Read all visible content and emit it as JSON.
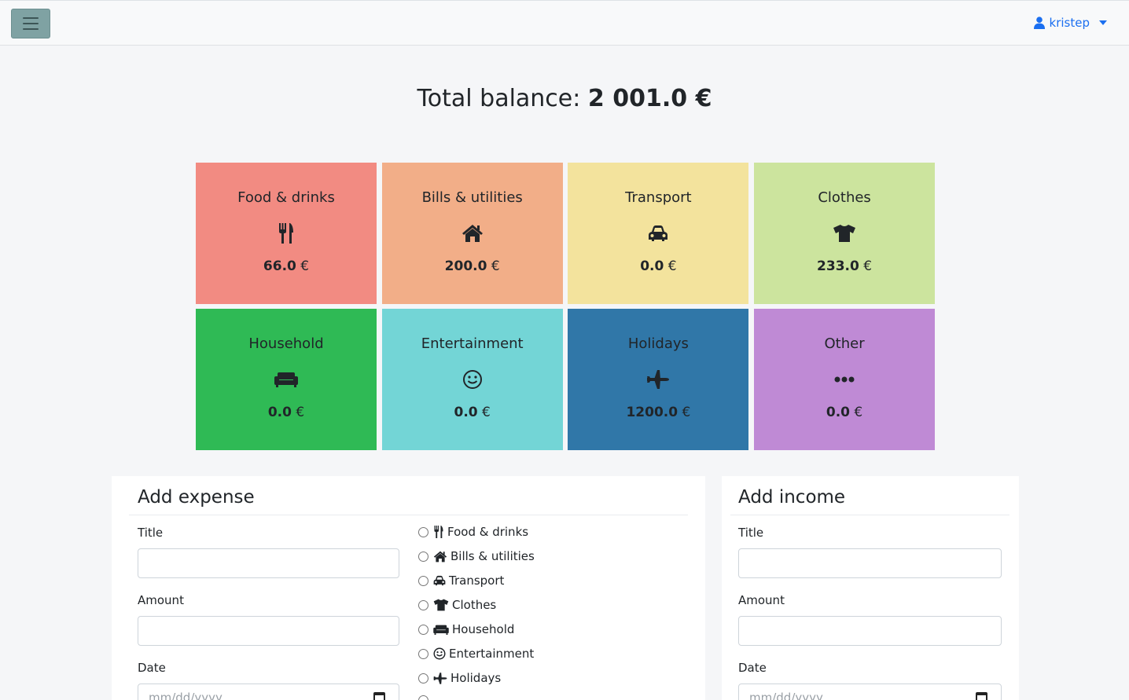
{
  "user": {
    "name": "kristep"
  },
  "total": {
    "label": "Total balance:",
    "amount": "2 001.0 €"
  },
  "categories": [
    {
      "name": "Food & drinks",
      "amount": "66.0",
      "currency": "€",
      "color": "#f28b82",
      "icon": "utensils-icon"
    },
    {
      "name": "Bills & utilities",
      "amount": "200.0",
      "currency": "€",
      "color": "#f2ae88",
      "icon": "home-icon"
    },
    {
      "name": "Transport",
      "amount": "0.0",
      "currency": "€",
      "color": "#f3e39d",
      "icon": "car-icon"
    },
    {
      "name": "Clothes",
      "amount": "233.0",
      "currency": "€",
      "color": "#cce49e",
      "icon": "tshirt-icon"
    },
    {
      "name": "Household",
      "amount": "0.0",
      "currency": "€",
      "color": "#2fba55",
      "icon": "couch-icon"
    },
    {
      "name": "Entertainment",
      "amount": "0.0",
      "currency": "€",
      "color": "#73d5d6",
      "icon": "smile-icon"
    },
    {
      "name": "Holidays",
      "amount": "1200.0",
      "currency": "€",
      "color": "#3077a8",
      "icon": "plane-icon"
    },
    {
      "name": "Other",
      "amount": "0.0",
      "currency": "€",
      "color": "#bf8ad5",
      "icon": "ellipsis-icon"
    }
  ],
  "expense": {
    "title": "Add expense",
    "fields": {
      "title": "Title",
      "amount": "Amount",
      "date": "Date",
      "date_placeholder": "mm/dd/yyyy"
    },
    "options": [
      "Food & drinks",
      "Bills & utilities",
      "Transport",
      "Clothes",
      "Household",
      "Entertainment",
      "Holidays"
    ]
  },
  "income": {
    "title": "Add income",
    "fields": {
      "title": "Title",
      "amount": "Amount",
      "date": "Date",
      "date_placeholder": "mm/dd/yyyy"
    }
  }
}
